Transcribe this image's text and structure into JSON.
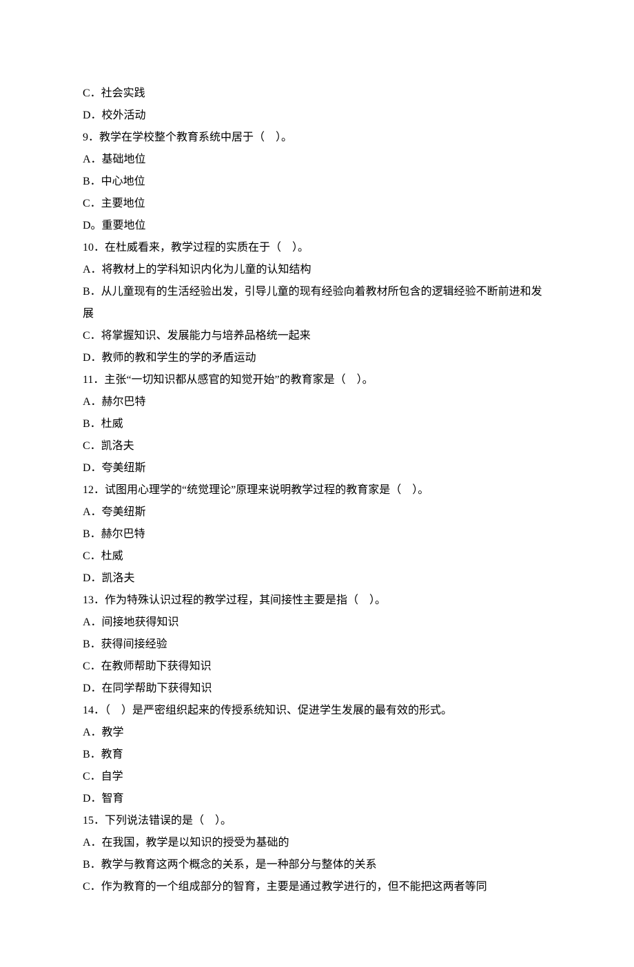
{
  "lines": [
    "C．社会实践",
    "D．校外活动",
    "9．教学在学校整个教育系统中居于（　）。",
    "A．基础地位",
    "B．中心地位",
    "C．主要地位",
    "D。重要地位",
    "10．在杜威看来，教学过程的实质在于（　）。",
    "A．将教材上的学科知识内化为儿童的认知结构",
    "B．从儿童现有的生活经验出发，引导儿童的现有经验向着教材所包含的逻辑经验不断前进和发展",
    "C．将掌握知识、发展能力与培养品格统一起来",
    "D．教师的教和学生的学的矛盾运动",
    "11．主张“一切知识都从感官的知觉开始”的教育家是（　）。",
    "A．赫尔巴特",
    "B．杜威",
    "C．凯洛夫",
    "D．夸美纽斯",
    "12．试图用心理学的“统觉理论”原理来说明教学过程的教育家是（　）。",
    "A．夸美纽斯",
    "B．赫尔巴特",
    "C．杜威",
    "D．凯洛夫",
    "13．作为特殊认识过程的教学过程，其间接性主要是指（　）。",
    "A．间接地获得知识",
    "B．获得间接经验",
    "C．在教师帮助下获得知识",
    "D．在同学帮助下获得知识",
    "14．（　）是严密组织起来的传授系统知识、促进学生发展的最有效的形式。",
    "A．教学",
    "B．教育",
    "C．自学",
    "D．智育",
    "15．下列说法错误的是（　）。",
    "A．在我国，教学是以知识的授受为基础的",
    "B．教学与教育这两个概念的关系，是一种部分与整体的关系",
    "C．作为教育的一个组成部分的智育，主要是通过教学进行的，但不能把这两者等同"
  ]
}
